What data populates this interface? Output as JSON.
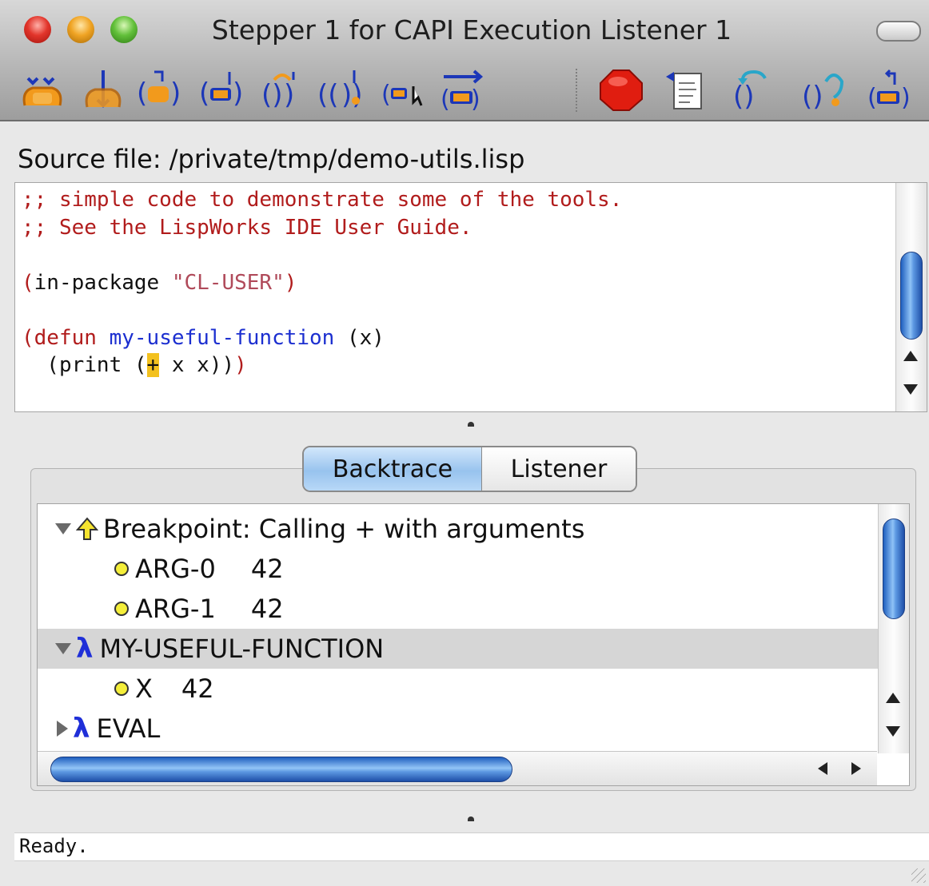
{
  "window": {
    "title": "Stepper 1 for CAPI Execution Listener 1"
  },
  "toolbar": {
    "buttons": [
      "step-through-call-icon",
      "step-into-icon",
      "step-to-value-icon",
      "step-to-end-icon",
      "step-over-form-icon",
      "step-to-call-icon",
      "step-to-cursor-icon",
      "continue-icon",
      "abort-icon",
      "show-source-icon",
      "undo-step-icon",
      "restart-icon",
      "return-icon"
    ]
  },
  "source": {
    "label": "Source file: /private/tmp/demo-utils.lisp",
    "lines": {
      "l1": ";; simple code to demonstrate some of the tools.",
      "l2": ";; See the LispWorks IDE User Guide.",
      "in_pkg_open": "(in-package ",
      "in_pkg_str": "\"CL-USER\"",
      "in_pkg_close": ")",
      "defun_open": "(defun ",
      "defun_name": "my-useful-function",
      "defun_args": " (x)",
      "print_open": "  (print (",
      "print_plus": "+",
      "print_rest": " x x)",
      "print_close1": ")",
      "print_close2": ")"
    }
  },
  "tabs": {
    "backtrace": "Backtrace",
    "listener": "Listener"
  },
  "backtrace": {
    "breakpoint": "Breakpoint: Calling + with arguments",
    "arg0_name": "ARG-0",
    "arg0_val": "42",
    "arg1_name": "ARG-1",
    "arg1_val": "42",
    "frame1": "MY-USEFUL-FUNCTION",
    "x_name": "X",
    "x_val": "42",
    "frame2": "EVAL",
    "lambda_glyph": "λ"
  },
  "status": {
    "text": "Ready."
  },
  "colors": {
    "comment": "#b11c1c",
    "function": "#1c2fd0",
    "highlight": "#f3c11e",
    "selection": "#d6d6d6"
  }
}
